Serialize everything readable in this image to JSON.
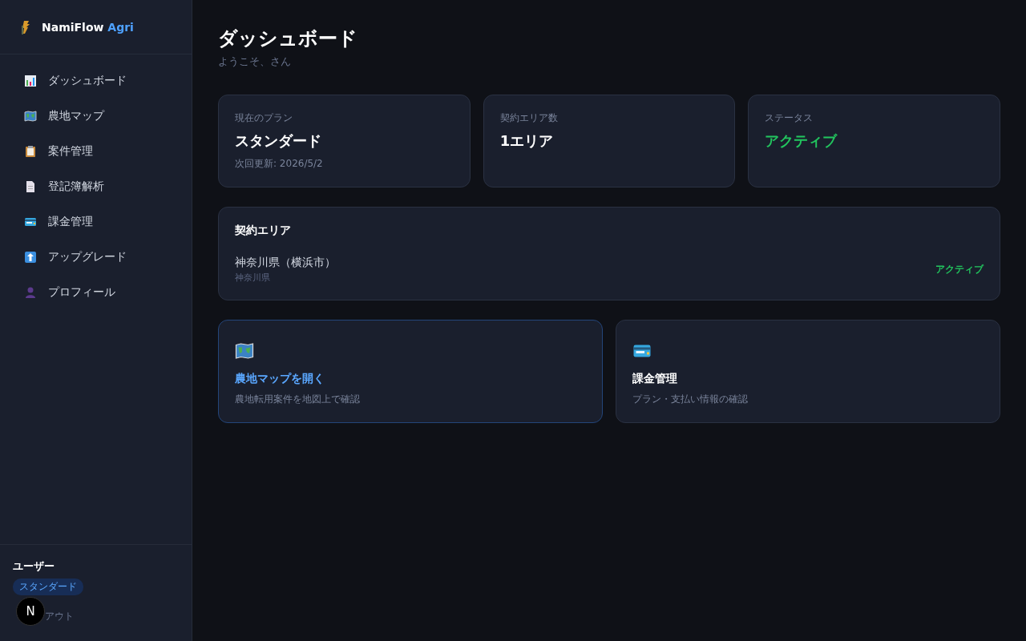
{
  "sidebar": {
    "brand": {
      "name": "NamiFlow",
      "accent": "Agri"
    },
    "items": [
      {
        "kind": "chart",
        "label": "ダッシュボード"
      },
      {
        "kind": "map",
        "label": "農地マップ"
      },
      {
        "kind": "clipboard",
        "label": "案件管理"
      },
      {
        "kind": "document",
        "label": "登記簿解析"
      },
      {
        "kind": "card",
        "label": "課金管理"
      },
      {
        "kind": "upgrade",
        "label": "アップグレード"
      },
      {
        "kind": "person",
        "label": "プロフィール"
      }
    ],
    "user": {
      "name": "ユーザー",
      "plan_badge": "スタンダード",
      "logout": "アウト",
      "dev_badge": "N"
    }
  },
  "header": {
    "title": "ダッシュボード",
    "subtitle": "ようこそ、さん"
  },
  "stats": [
    {
      "label": "現在のプラン",
      "value": "スタンダード",
      "note": "次回更新: 2026/5/2",
      "kind": "plain"
    },
    {
      "label": "契約エリア数",
      "value": "1エリア",
      "kind": "plain"
    },
    {
      "label": "ステータス",
      "value": "アクティブ",
      "kind": "status"
    }
  ],
  "areas": {
    "title": "契約エリア",
    "rows": [
      {
        "name": "神奈川県（横浜市）",
        "prefecture": "神奈川県",
        "status": "アクティブ"
      }
    ]
  },
  "actions": [
    {
      "kind": "map",
      "title": "農地マップを開く",
      "description": "農地転用案件を地図上で確認",
      "highlighted": true
    },
    {
      "kind": "card",
      "title": "課金管理",
      "description": "プラン・支払い情報の確認",
      "highlighted": false
    }
  ]
}
